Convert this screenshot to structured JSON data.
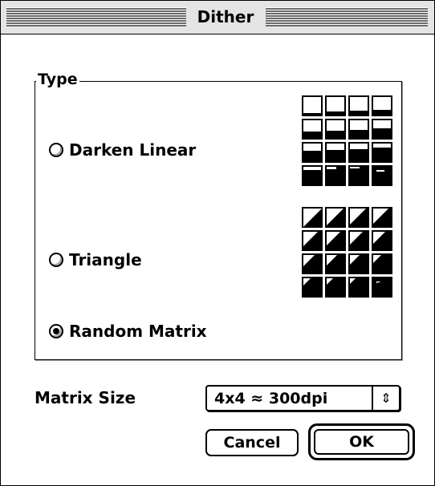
{
  "window": {
    "title": "Dither"
  },
  "group": {
    "label": "Type"
  },
  "options": [
    {
      "label": "Darken Linear",
      "checked": false
    },
    {
      "label": "Triangle",
      "checked": false
    },
    {
      "label": "Random Matrix",
      "checked": true
    }
  ],
  "matrix_size": {
    "label": "Matrix Size",
    "value": "4x4 ≈ 300dpi",
    "arrow": "⇕"
  },
  "buttons": {
    "cancel": "Cancel",
    "ok": "OK"
  },
  "patterns": {
    "darken_linear": "16-cell dither preview, horizontal fill pattern",
    "triangle": "16-cell dither preview, triangular fill pattern"
  }
}
